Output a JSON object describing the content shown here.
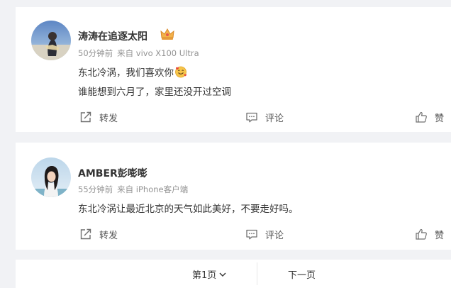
{
  "posts": [
    {
      "username": "涛涛在追逐太阳",
      "time": "50分钟前",
      "source": "来自 vivo X100 Ultra",
      "lines": [
        "东北冷涡，我们喜欢你",
        "谁能想到六月了，家里还没开过空调"
      ],
      "actions": {
        "repost": "转发",
        "comment": "评论",
        "like": "赞"
      },
      "badge_icon": "crown-badge-icon",
      "emoji": "smiling-face-with-hearts"
    },
    {
      "username": "AMBER彭嘭嘭",
      "time": "55分钟前",
      "source": "来自 iPhone客户端",
      "lines": [
        "东北冷涡让最近北京的天气如此美好，不要走好吗。"
      ],
      "actions": {
        "repost": "转发",
        "comment": "评论",
        "like": "赞"
      }
    }
  ],
  "pagination": {
    "current": "第1页",
    "next": "下一页"
  },
  "colors": {
    "background": "#f1f2f5",
    "card": "#ffffff",
    "meta_text": "#939393"
  }
}
